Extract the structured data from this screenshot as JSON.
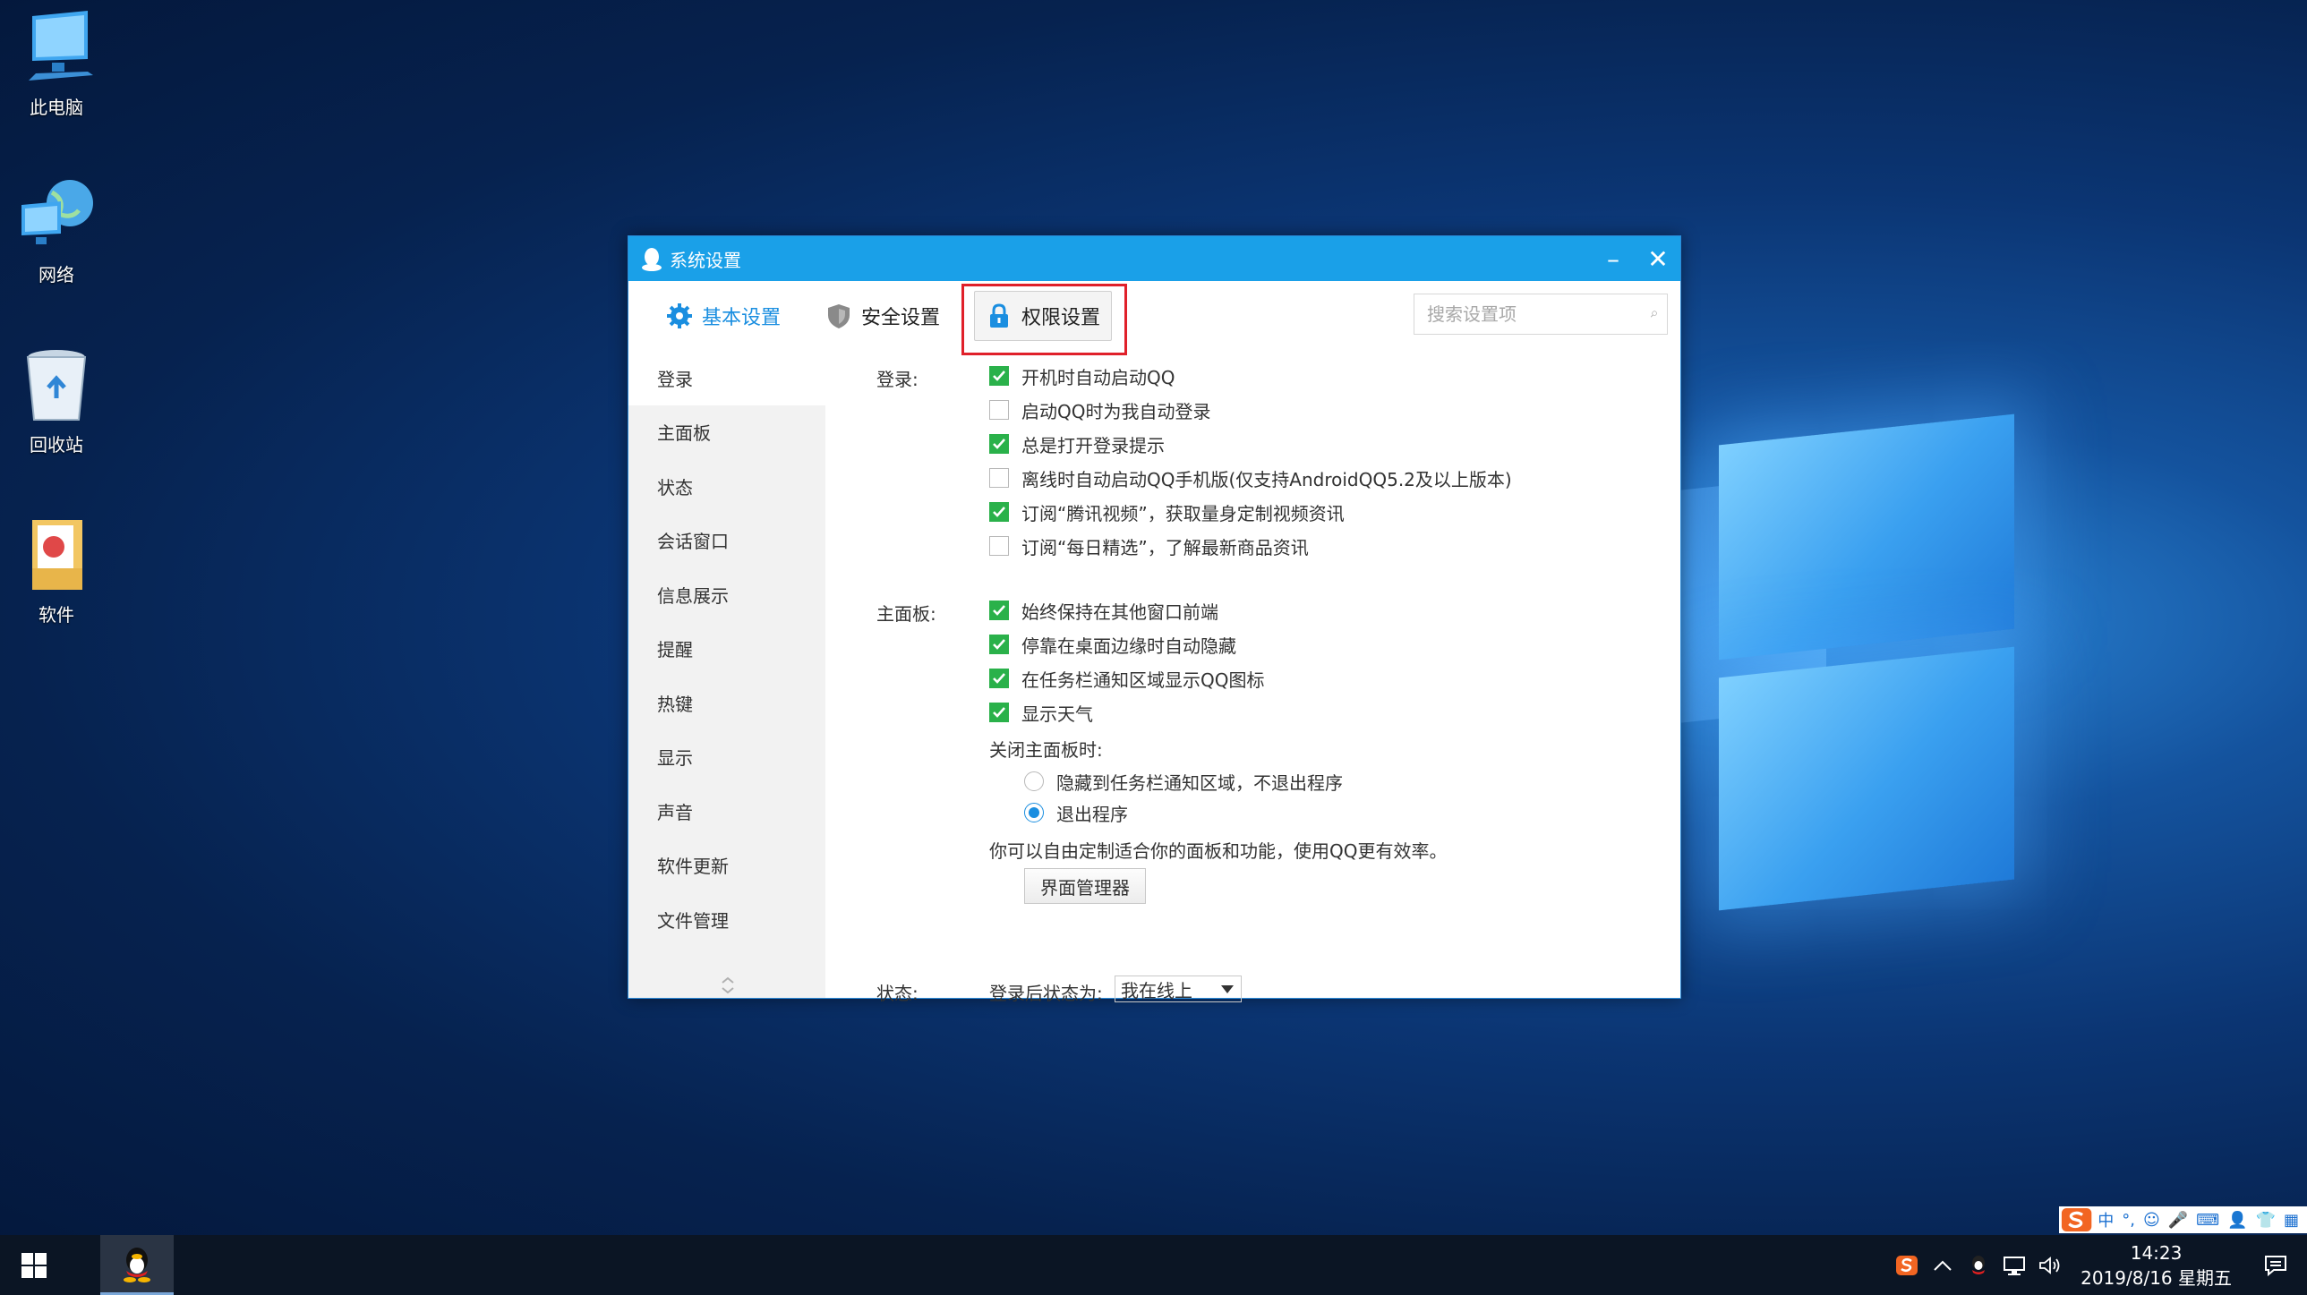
{
  "desktop": {
    "icons": [
      {
        "label": "此电脑",
        "icon": "computer-icon"
      },
      {
        "label": "网络",
        "icon": "network-icon"
      },
      {
        "label": "回收站",
        "icon": "recycle-bin-icon"
      },
      {
        "label": "软件",
        "icon": "folder-icon"
      }
    ]
  },
  "dialog": {
    "title": "系统设置",
    "minimize": "–",
    "close": "✕",
    "tabs": [
      {
        "label": "基本设置",
        "icon": "gear-icon",
        "active": true
      },
      {
        "label": "安全设置",
        "icon": "shield-icon",
        "active": false
      },
      {
        "label": "权限设置",
        "icon": "lock-icon",
        "active": false
      }
    ],
    "search_placeholder": "搜索设置项",
    "sidebar": [
      {
        "label": "登录"
      },
      {
        "label": "主面板"
      },
      {
        "label": "状态"
      },
      {
        "label": "会话窗口"
      },
      {
        "label": "信息展示"
      },
      {
        "label": "提醒"
      },
      {
        "label": "热键"
      },
      {
        "label": "显示"
      },
      {
        "label": "声音"
      },
      {
        "label": "软件更新"
      },
      {
        "label": "文件管理"
      }
    ],
    "login": {
      "label": "登录:",
      "options": [
        {
          "text": "开机时自动启动QQ",
          "checked": true
        },
        {
          "text": "启动QQ时为我自动登录",
          "checked": false
        },
        {
          "text": "总是打开登录提示",
          "checked": true
        },
        {
          "text": "离线时自动启动QQ手机版(仅支持AndroidQQ5.2及以上版本)",
          "checked": false
        },
        {
          "text": "订阅“腾讯视频”，获取量身定制视频资讯",
          "checked": true
        },
        {
          "text": "订阅“每日精选”，了解最新商品资讯",
          "checked": false
        }
      ]
    },
    "mainpanel": {
      "label": "主面板:",
      "options": [
        {
          "text": "始终保持在其他窗口前端",
          "checked": true
        },
        {
          "text": "停靠在桌面边缘时自动隐藏",
          "checked": true
        },
        {
          "text": "在任务栏通知区域显示QQ图标",
          "checked": true
        },
        {
          "text": "显示天气",
          "checked": true
        }
      ],
      "close_label": "关闭主面板时:",
      "radios": [
        {
          "text": "隐藏到任务栏通知区域，不退出程序",
          "selected": false
        },
        {
          "text": "退出程序",
          "selected": true
        }
      ],
      "hint": "你可以自由定制适合你的面板和功能，使用QQ更有效率。",
      "manager_button": "界面管理器"
    },
    "status": {
      "label": "状态:",
      "after_login_label": "登录后状态为:",
      "value": "我在线上"
    }
  },
  "taskbar": {
    "ime": [
      "中",
      "°,",
      "☺",
      "🎤",
      "⌨",
      "👤",
      "👕",
      "▦"
    ],
    "time": "14:23",
    "date": "2019/8/16 星期五"
  }
}
